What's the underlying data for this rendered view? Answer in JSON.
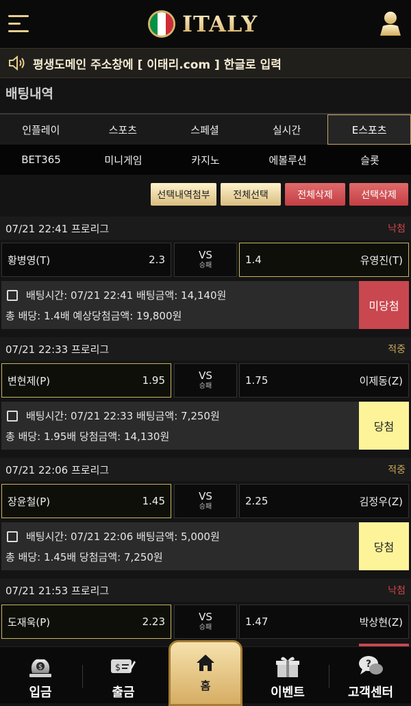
{
  "header": {
    "logo_text": "ITALY",
    "flag_colors": [
      "#009246",
      "#ffffff",
      "#ce2b37"
    ],
    "menu_icon": "hamburger-menu-icon",
    "user_icon": "user-icon"
  },
  "notice": {
    "icon": "speaker-icon",
    "text": "평생도메인 주소창에 [ 이태리.com ] 한글로 입력"
  },
  "page_title": "배팅내역",
  "tabs_row1": [
    "인플레이",
    "스포츠",
    "스페셜",
    "실시간",
    "E스포츠"
  ],
  "tabs_row2": [
    "BET365",
    "미니게임",
    "카지노",
    "에볼루션",
    "슬롯"
  ],
  "active_tab": "E스포츠",
  "actions": {
    "attach": "선택내역첨부",
    "select_all": "전체선택",
    "delete_all": "전체삭제",
    "delete_selected": "선택삭제"
  },
  "bets": [
    {
      "date": "07/21 22:41 프로리그",
      "status": "낙첨",
      "home": "황병영(T)",
      "home_odds": "2.3",
      "vs": "VS",
      "vs_sub": "승패",
      "away": "유영진(T)",
      "away_odds": "1.4",
      "selected": "away",
      "line1": "배팅시간: 07/21 22:41 배팅금액: 14,140원",
      "line2": "총 배당: 1.4배 예상당첨금액: 19,800원",
      "result": "미당첨"
    },
    {
      "date": "07/21 22:33 프로리그",
      "status": "적중",
      "home": "변현제(P)",
      "home_odds": "1.95",
      "vs": "VS",
      "vs_sub": "승패",
      "away": "이제동(Z)",
      "away_odds": "1.75",
      "selected": "home",
      "line1": "배팅시간: 07/21 22:33 배팅금액: 7,250원",
      "line2": "총 배당: 1.95배 당첨금액: 14,130원",
      "result": "당첨"
    },
    {
      "date": "07/21 22:06 프로리그",
      "status": "적중",
      "home": "장윤철(P)",
      "home_odds": "1.45",
      "vs": "VS",
      "vs_sub": "승패",
      "away": "김정우(Z)",
      "away_odds": "2.25",
      "selected": "home",
      "line1": "배팅시간: 07/21 22:06 배팅금액: 5,000원",
      "line2": "총 배당: 1.45배 당첨금액: 7,250원",
      "result": "당첨"
    },
    {
      "date": "07/21 21:53 프로리그",
      "status": "낙첨",
      "home": "도재욱(P)",
      "home_odds": "2.23",
      "vs": "VS",
      "vs_sub": "승패",
      "away": "박상현(Z)",
      "away_odds": "1.47",
      "selected": "home"
    }
  ],
  "bottom_nav": {
    "deposit": "입금",
    "withdraw": "출금",
    "home": "홈",
    "event": "이벤트",
    "support": "고객센터"
  }
}
